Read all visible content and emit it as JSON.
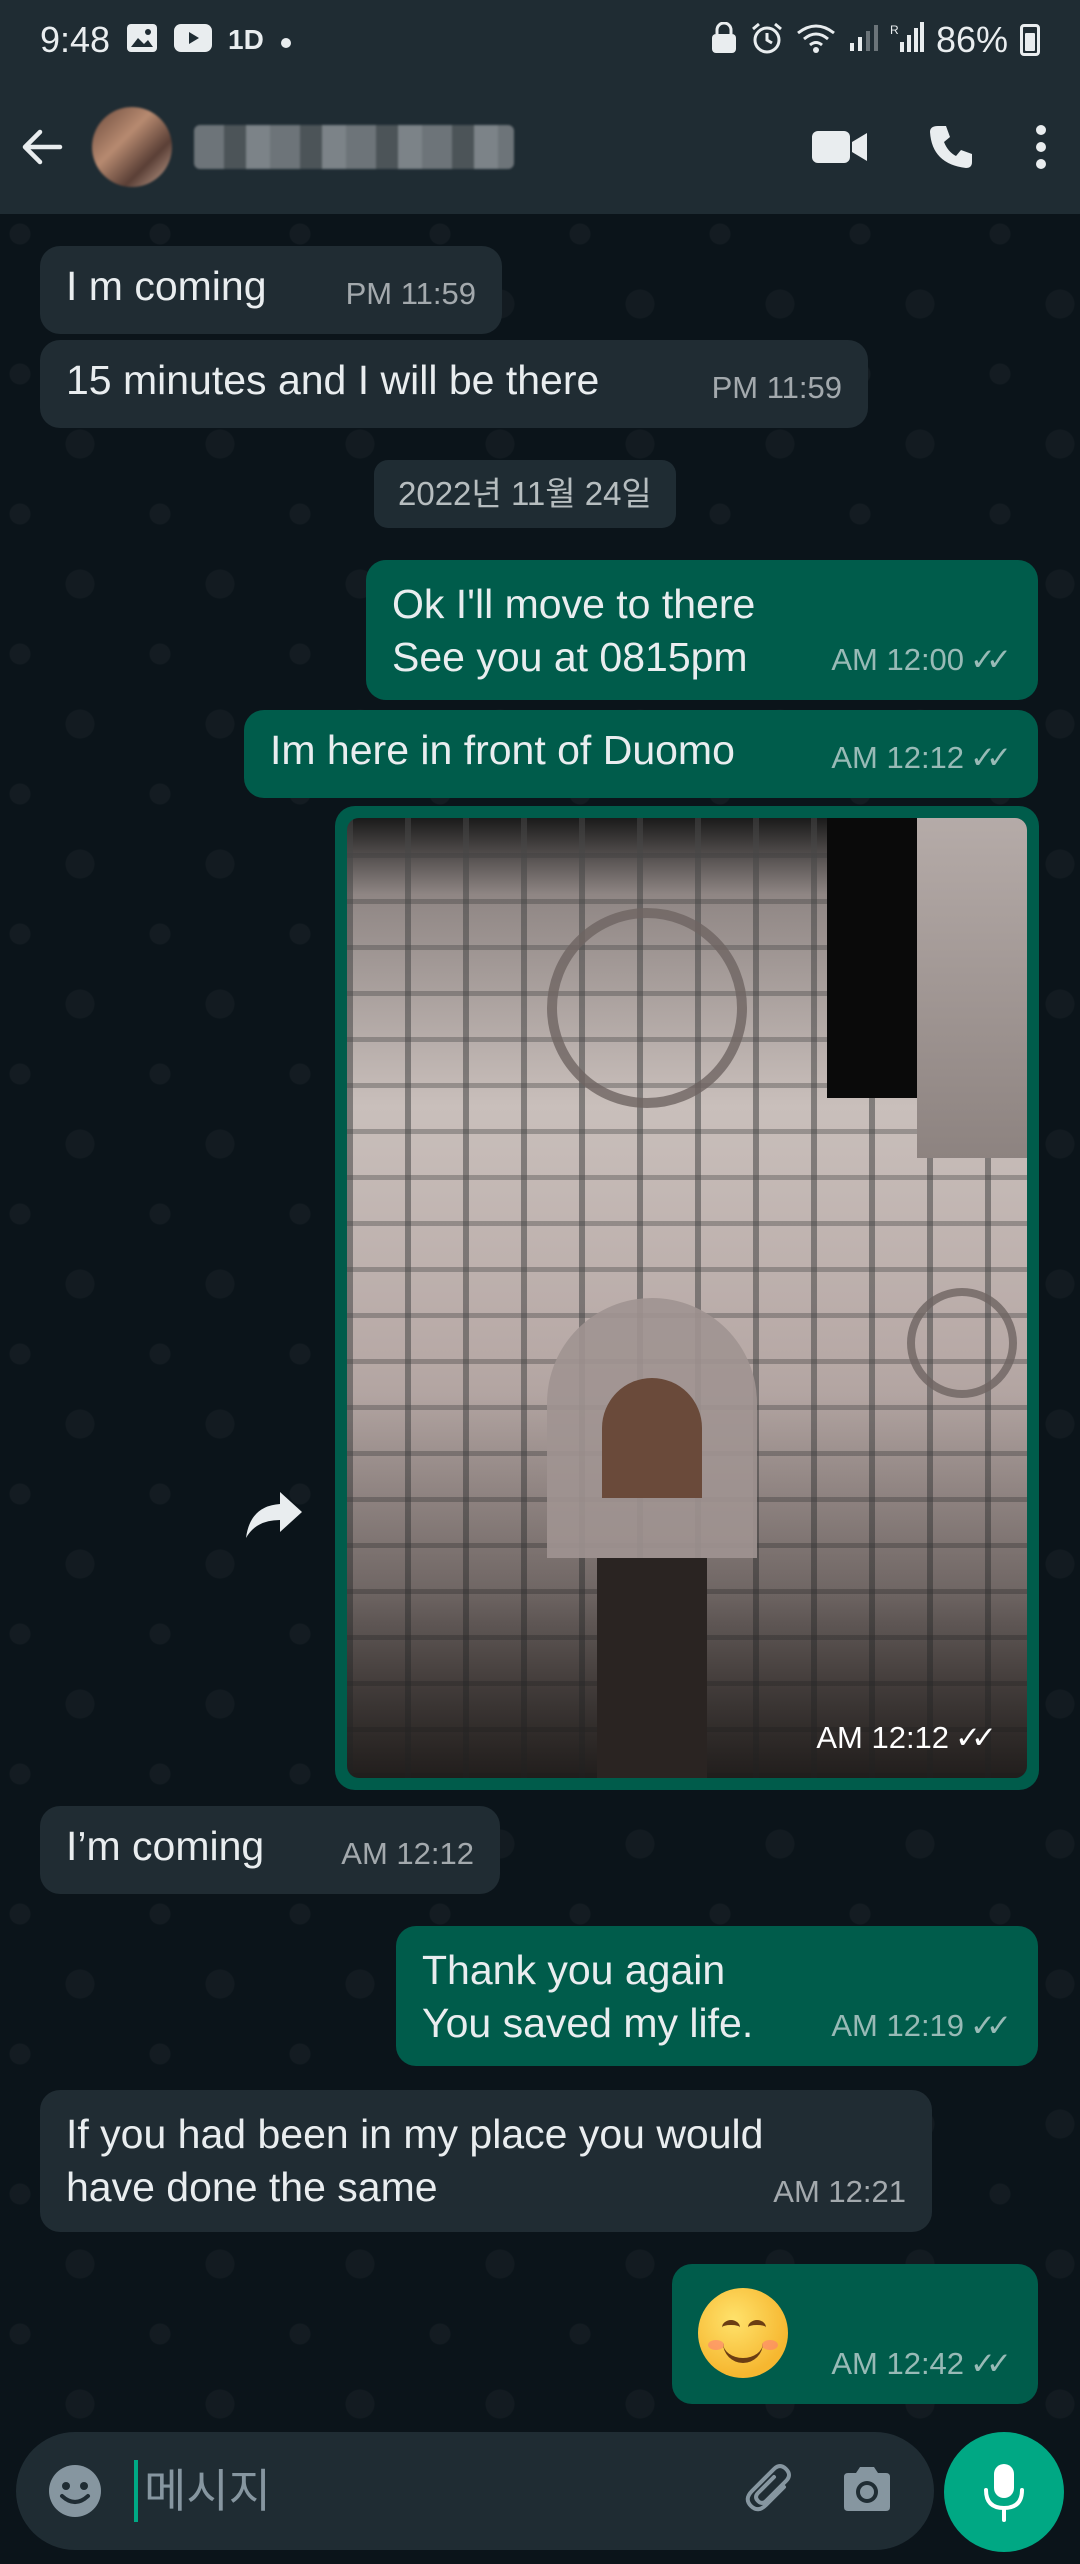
{
  "status_bar": {
    "time": "9:48",
    "battery_text": "86%",
    "icons": [
      "gallery-icon",
      "youtube-icon",
      "1d-icon",
      "dot-icon",
      "lock-icon",
      "alarm-icon",
      "wifi-icon",
      "signal-icon",
      "signal-r-icon",
      "battery-icon"
    ]
  },
  "header": {
    "contact_name_redacted": true,
    "actions": [
      "video-call-icon",
      "voice-call-icon",
      "more-vert-icon"
    ]
  },
  "chat": {
    "messages": [
      {
        "direction": "in",
        "text": "I m coming",
        "time": "PM 11:59"
      },
      {
        "direction": "in",
        "text": "15 minutes and I will be there",
        "time": "PM 11:59"
      },
      {
        "type": "date",
        "text": "2022년 11월 24일"
      },
      {
        "direction": "out",
        "text": "Ok I'll move to there\nSee you at 0815pm",
        "time": "AM 12:00",
        "read": true
      },
      {
        "direction": "out",
        "text": "Im here in front of Duomo",
        "time": "AM 12:12",
        "read": true
      },
      {
        "direction": "out",
        "type": "image",
        "time": "AM 12:12",
        "read": true
      },
      {
        "direction": "in",
        "text": "I’m coming",
        "time": "AM 12:12"
      },
      {
        "direction": "out",
        "text": "Thank you again\nYou saved my life.",
        "time": "AM 12:19",
        "read": true
      },
      {
        "direction": "in",
        "text": "If you had been in my place you would\nhave done the same",
        "time": "AM 12:21"
      },
      {
        "direction": "out",
        "type": "emoji",
        "emoji": "smiling-face-icon",
        "time": "AM 12:42",
        "read": true
      }
    ]
  },
  "composer": {
    "placeholder": "메시지",
    "value": ""
  },
  "colors": {
    "background": "#0b141a",
    "bar": "#1f2c33",
    "incoming_bubble": "#202c33",
    "outgoing_bubble": "#005c4b",
    "accent": "#00a884"
  }
}
